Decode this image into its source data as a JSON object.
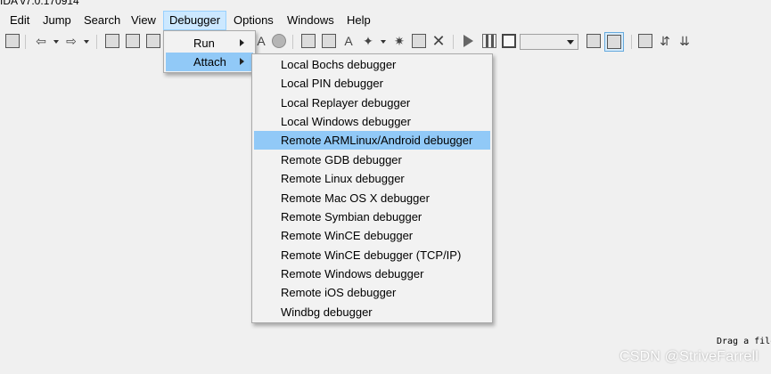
{
  "window": {
    "title": "IDA v7.0.170914"
  },
  "menubar": {
    "items": [
      {
        "label": "Edit"
      },
      {
        "label": "Jump"
      },
      {
        "label": "Search"
      },
      {
        "label": "View"
      },
      {
        "label": "Debugger"
      },
      {
        "label": "Options"
      },
      {
        "label": "Windows"
      },
      {
        "label": "Help"
      }
    ],
    "open_item": "Debugger"
  },
  "debugger_menu": {
    "items": [
      {
        "label": "Run",
        "has_submenu": true
      },
      {
        "label": "Attach",
        "has_submenu": true,
        "highlighted": true
      }
    ]
  },
  "attach_submenu": {
    "items": [
      {
        "label": "Local Bochs debugger"
      },
      {
        "label": "Local PIN debugger"
      },
      {
        "label": "Local Replayer debugger"
      },
      {
        "label": "Local Windows debugger"
      },
      {
        "label": "Remote ARMLinux/Android debugger",
        "highlighted": true
      },
      {
        "label": "Remote GDB debugger"
      },
      {
        "label": "Remote Linux debugger"
      },
      {
        "label": "Remote Mac OS X debugger"
      },
      {
        "label": "Remote Symbian debugger"
      },
      {
        "label": "Remote WinCE debugger"
      },
      {
        "label": "Remote WinCE debugger (TCP/IP)"
      },
      {
        "label": "Remote Windows debugger"
      },
      {
        "label": "Remote iOS debugger"
      },
      {
        "label": "Windbg debugger"
      }
    ]
  },
  "toolbar": {
    "debugger_select_value": ""
  },
  "main": {
    "drag_hint": "Drag a file"
  },
  "watermark": {
    "text": "CSDN @StriveFarrell"
  },
  "colors": {
    "highlight": "#91c9f7",
    "menu_open": "#cce8ff",
    "menu_bg": "#f2f2f2",
    "app_bg": "#f0f0f0"
  }
}
